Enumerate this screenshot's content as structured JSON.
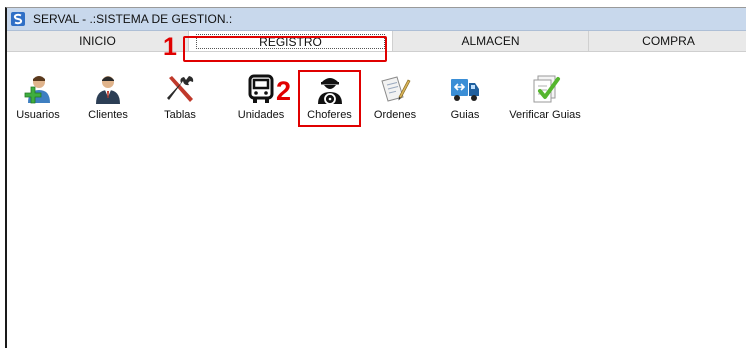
{
  "window": {
    "title": "SERVAL - .:SISTEMA DE GESTION.:"
  },
  "tabs": [
    {
      "label": "INICIO"
    },
    {
      "label": "REGISTRO",
      "selected": true
    },
    {
      "label": "ALMACEN"
    },
    {
      "label": "COMPRA"
    }
  ],
  "toolbar": [
    {
      "label": "Usuarios",
      "icon": "users-icon"
    },
    {
      "label": "Clientes",
      "icon": "clients-icon"
    },
    {
      "label": "Tablas",
      "icon": "tools-icon"
    },
    {
      "label": "Unidades",
      "icon": "bus-icon"
    },
    {
      "label": "Choferes",
      "icon": "driver-icon"
    },
    {
      "label": "Ordenes",
      "icon": "orders-icon"
    },
    {
      "label": "Guias",
      "icon": "truck-icon"
    },
    {
      "label": "Verificar Guias",
      "icon": "verify-docs-icon"
    }
  ],
  "annotations": [
    {
      "label": "1"
    },
    {
      "label": "2"
    }
  ],
  "colors": {
    "annotation": "#e00000",
    "titlebar": "#c8d8ec",
    "tabbar": "#e9e9e9"
  }
}
